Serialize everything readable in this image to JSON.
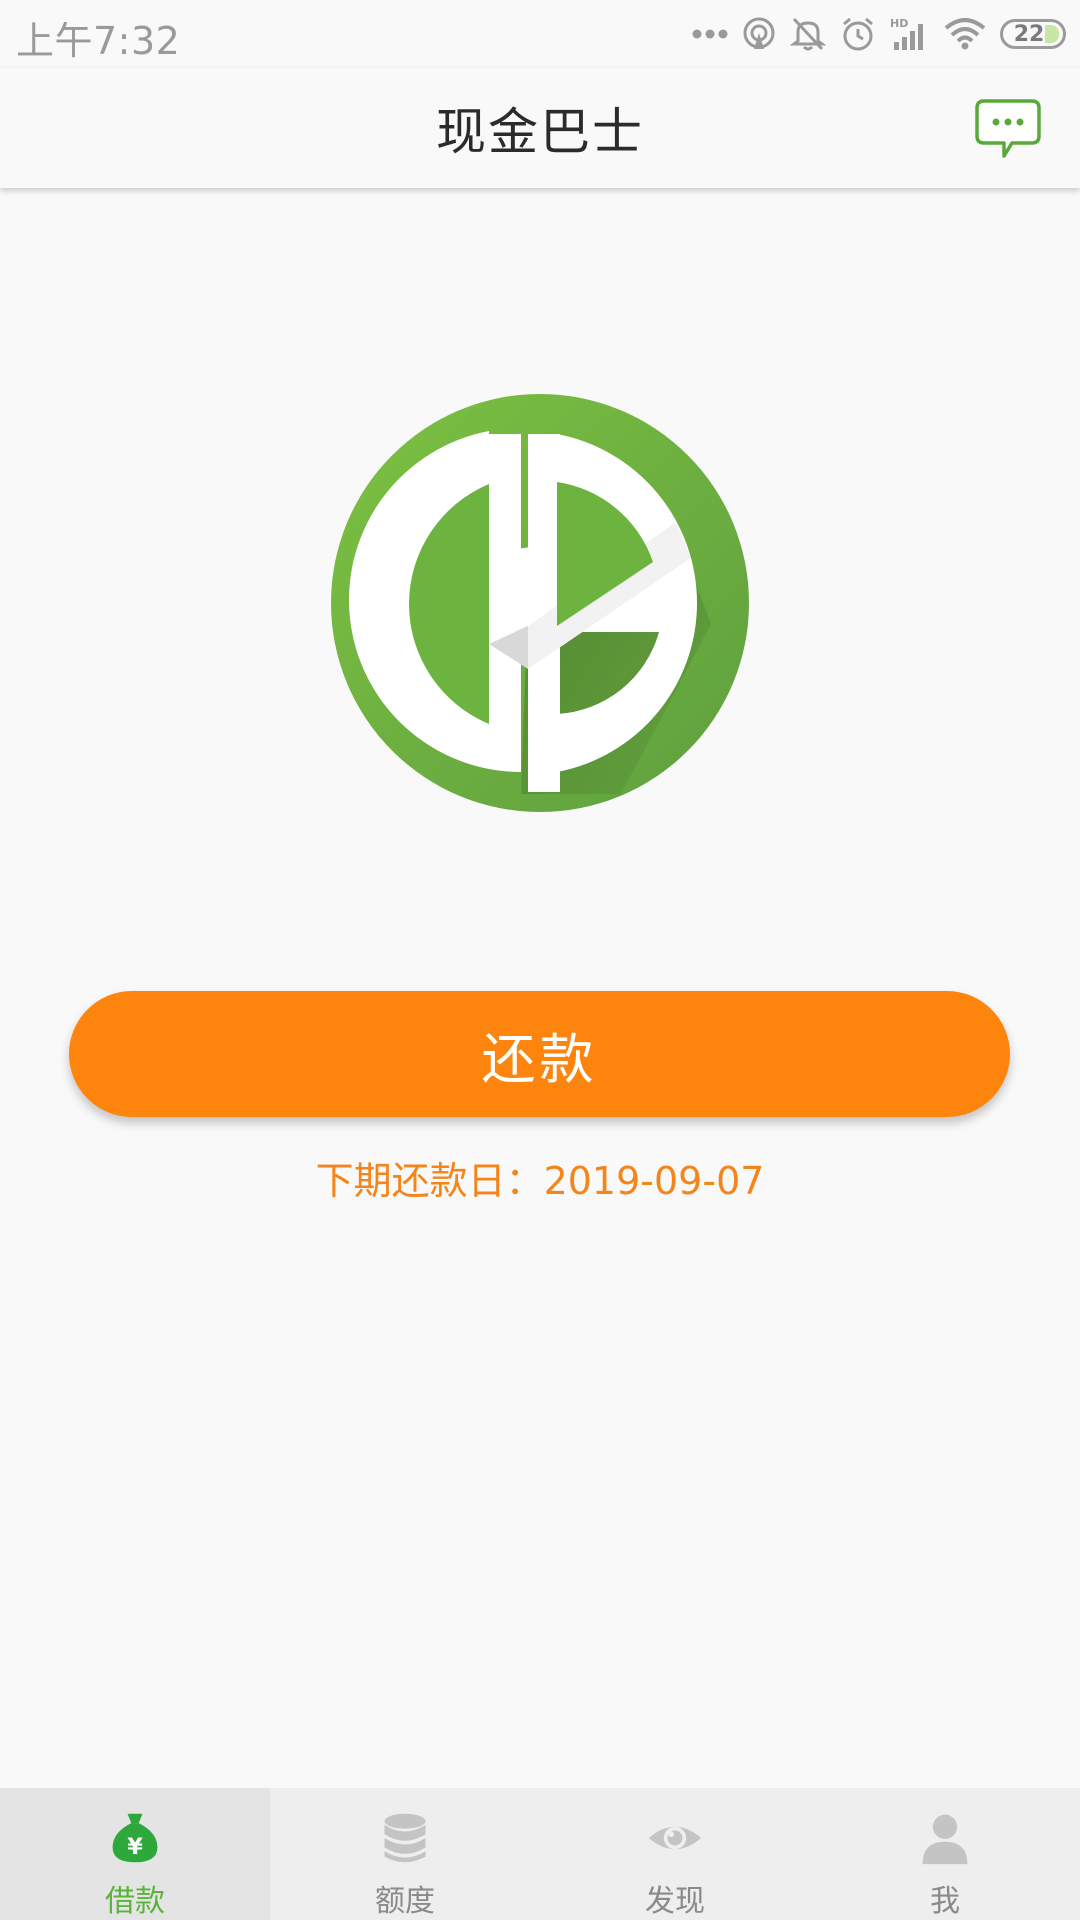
{
  "status_bar": {
    "time": "上午7:32",
    "battery_level": "22",
    "icons": [
      "more-dots-icon",
      "hotspot-icon",
      "mute-icon",
      "alarm-icon",
      "hd-signal-icon",
      "wifi-icon",
      "battery-icon"
    ]
  },
  "header": {
    "title": "现金巴士",
    "message_icon": "chat-bubble-icon"
  },
  "main": {
    "logo": "cashbus-logo",
    "repay_button": "还款",
    "next_due_label": "下期还款日：2019-09-07"
  },
  "bottom_nav": {
    "items": [
      {
        "label": "借款",
        "icon": "money-bag-icon",
        "active": true
      },
      {
        "label": "额度",
        "icon": "database-icon",
        "active": false
      },
      {
        "label": "发现",
        "icon": "eye-icon",
        "active": false
      },
      {
        "label": "我",
        "icon": "person-icon",
        "active": false
      }
    ]
  },
  "colors": {
    "brand_green": "#6db33f",
    "accent_orange": "#fd850e",
    "active_nav": "#5ab43c",
    "inactive_nav": "#8a8a8a"
  }
}
